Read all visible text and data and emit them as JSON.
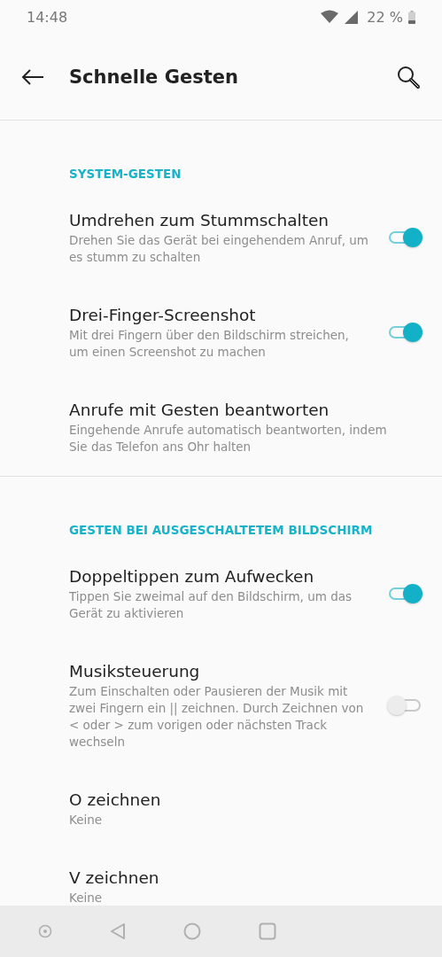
{
  "status_bar": {
    "time": "14:48",
    "battery": "22 %"
  },
  "toolbar": {
    "title": "Schnelle Gesten"
  },
  "sections": [
    {
      "header": "SYSTEM-GESTEN",
      "items": [
        {
          "kind": "toggle",
          "title": "Umdrehen zum Stummschalten",
          "summary": "Drehen Sie das Gerät bei eingehendem Anruf, um es stumm zu schalten",
          "on": true
        },
        {
          "kind": "toggle",
          "title": "Drei-Finger-Screenshot",
          "summary": "Mit drei Fingern über den Bildschirm streichen, um einen Screenshot zu machen",
          "on": true
        },
        {
          "kind": "plain",
          "title": "Anrufe mit Gesten beantworten",
          "summary": "Eingehende Anrufe automatisch beantworten, indem Sie das Telefon ans Ohr halten"
        }
      ]
    },
    {
      "header": "GESTEN BEI AUSGESCHALTETEM BILDSCHIRM",
      "items": [
        {
          "kind": "toggle",
          "title": "Doppeltippen zum Aufwecken",
          "summary": "Tippen Sie zweimal auf den Bildschirm, um das Gerät zu aktivieren",
          "on": true
        },
        {
          "kind": "toggle",
          "title": "Musiksteuerung",
          "summary": "Zum Einschalten oder Pausieren der Musik mit zwei Fingern ein || zeichnen. Durch Zeichnen von < oder > zum vorigen oder nächsten Track wechseln",
          "on": false
        },
        {
          "kind": "plain",
          "title": "O zeichnen",
          "summary": "Keine"
        },
        {
          "kind": "plain",
          "title": "V zeichnen",
          "summary": "Keine"
        }
      ]
    }
  ]
}
